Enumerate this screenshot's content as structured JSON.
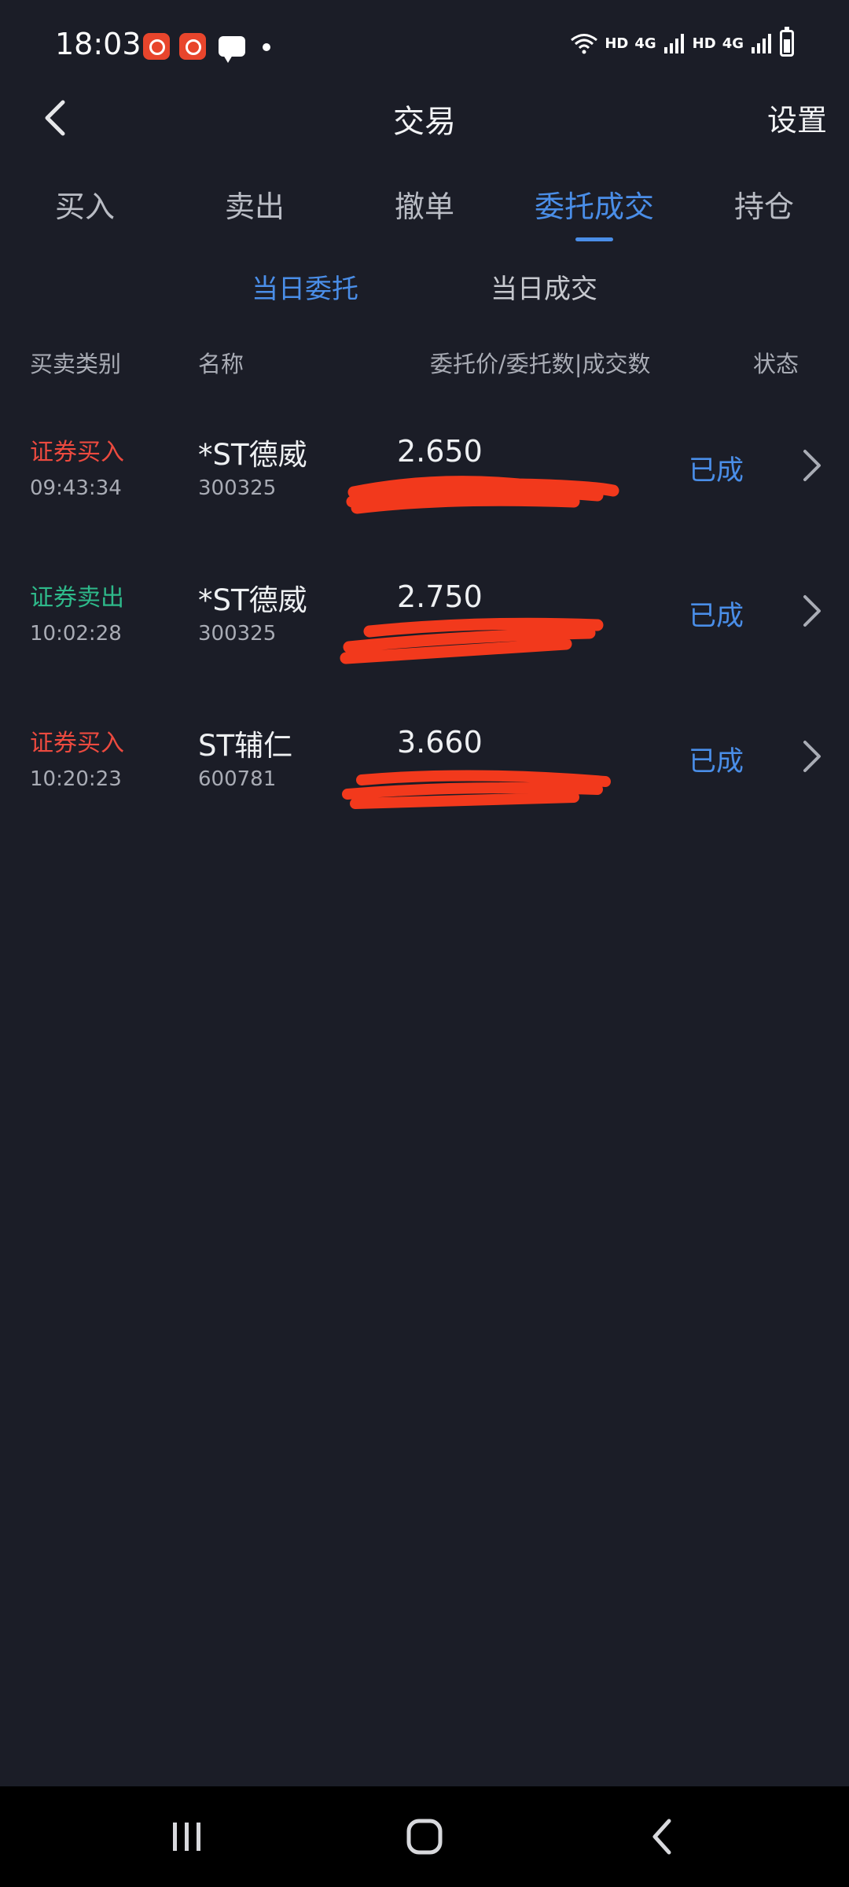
{
  "status_bar": {
    "time": "18:03",
    "hd1": "HD",
    "net1": "4G",
    "hd2": "HD",
    "net2": "4G"
  },
  "header": {
    "title": "交易",
    "settings_label": "设置"
  },
  "tabs": [
    {
      "label": "买入",
      "active": false
    },
    {
      "label": "卖出",
      "active": false
    },
    {
      "label": "撤单",
      "active": false
    },
    {
      "label": "委托成交",
      "active": true
    },
    {
      "label": "持仓",
      "active": false
    }
  ],
  "subtabs": [
    {
      "label": "当日委托",
      "active": true
    },
    {
      "label": "当日成交",
      "active": false
    }
  ],
  "columns": {
    "type": "买卖类别",
    "name": "名称",
    "price": "委托价/委托数|成交数",
    "status": "状态"
  },
  "orders": [
    {
      "type": "证券买入",
      "side": "buy",
      "time": "09:43:34",
      "name": "*ST德威",
      "code": "300325",
      "price": "2.650",
      "status": "已成"
    },
    {
      "type": "证券卖出",
      "side": "sell",
      "time": "10:02:28",
      "name": "*ST德威",
      "code": "300325",
      "price": "2.750",
      "status": "已成"
    },
    {
      "type": "证券买入",
      "side": "buy",
      "time": "10:20:23",
      "name": "ST辅仁",
      "code": "600781",
      "price": "3.660",
      "status": "已成"
    }
  ],
  "colors": {
    "background": "#1b1d27",
    "accent": "#4a8ee8",
    "buy": "#ec4a3f",
    "sell": "#2eb98a",
    "redaction": "#f2391c"
  },
  "icons": {
    "back": "chevron-left-icon",
    "row_arrow": "chevron-right-icon",
    "nav_recents": "recents-icon",
    "nav_home": "home-icon",
    "nav_back": "back-icon"
  }
}
